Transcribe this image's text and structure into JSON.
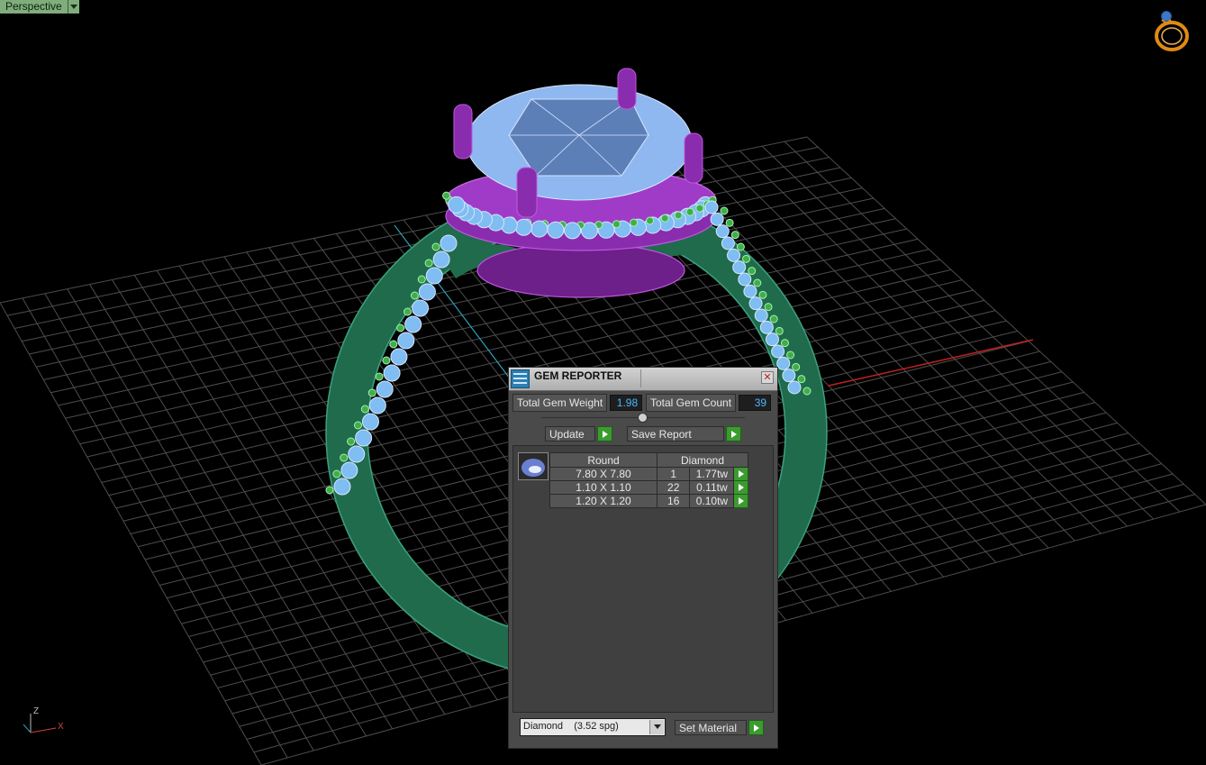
{
  "viewport": {
    "view_label": "Perspective",
    "axis_labels": {
      "z": "Z",
      "x": "X"
    }
  },
  "gem_reporter": {
    "title": "GEM REPORTER",
    "total_weight_label": "Total Gem Weight",
    "total_weight_value": "1.98",
    "total_count_label": "Total Gem Count",
    "total_count_value": "39",
    "update_label": "Update",
    "save_report_label": "Save Report",
    "table": {
      "shape_header": "Round",
      "material_header": "Diamond",
      "rows": [
        {
          "size": "7.80 X 7.80",
          "count": "1",
          "weight": "1.77tw"
        },
        {
          "size": "1.10 X 1.10",
          "count": "22",
          "weight": "0.11tw"
        },
        {
          "size": "1.20 X 1.20",
          "count": "16",
          "weight": "0.10tw"
        }
      ]
    },
    "material_select_value": "Diamond    (3.52 spg)",
    "set_material_label": "Set Material"
  },
  "icons": [
    "dropdown-arrow-icon",
    "ring-logo-icon",
    "axis-gizmo-icon",
    "gem-reporter-app-icon",
    "close-icon",
    "collapse-icon",
    "play-arrow-icon",
    "round-gem-icon"
  ],
  "colors": {
    "band": "#1f6b4c",
    "band_highlight": "#3da080",
    "head": "#8a2cae",
    "center_stone": "#8fb8f0",
    "accent_stones": "#7fbdf2",
    "grid": "#4d4d4d",
    "x_axis": "#c02020",
    "value_text": "#49b8ff",
    "go_button": "#3b9b2f"
  }
}
